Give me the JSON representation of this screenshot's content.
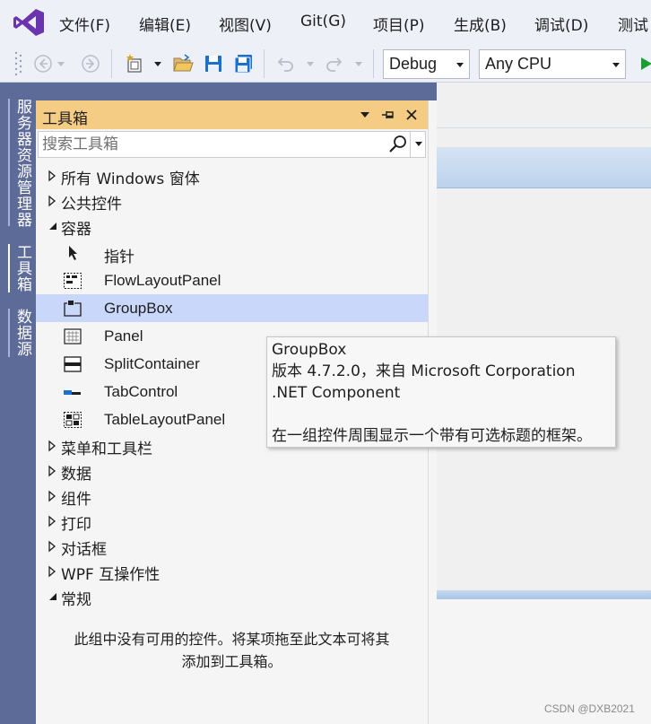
{
  "menu": {
    "items": [
      "文件(F)",
      "编辑(E)",
      "视图(V)",
      "Git(G)",
      "项目(P)",
      "生成(B)",
      "调试(D)",
      "测试"
    ]
  },
  "toolbar": {
    "configuration": "Debug",
    "platform": "Any CPU"
  },
  "side_tabs": [
    "服务器资源管理器",
    "工具箱",
    "数据源"
  ],
  "toolbox": {
    "title": "工具箱",
    "search_placeholder": "搜索工具箱",
    "groups_top": [
      {
        "label": "所有 Windows 窗体",
        "expanded": false
      },
      {
        "label": "公共控件",
        "expanded": false
      },
      {
        "label": "容器",
        "expanded": true
      }
    ],
    "container_items": [
      {
        "label": "指针",
        "icon": "pointer-icon",
        "selected": false
      },
      {
        "label": "FlowLayoutPanel",
        "icon": "flowlayoutpanel-icon",
        "selected": false
      },
      {
        "label": "GroupBox",
        "icon": "groupbox-icon",
        "selected": true
      },
      {
        "label": "Panel",
        "icon": "panel-icon",
        "selected": false
      },
      {
        "label": "SplitContainer",
        "icon": "splitcontainer-icon",
        "selected": false
      },
      {
        "label": "TabControl",
        "icon": "tabcontrol-icon",
        "selected": false
      },
      {
        "label": "TableLayoutPanel",
        "icon": "tablelayoutpanel-icon",
        "selected": false
      }
    ],
    "groups_bottom": [
      {
        "label": "菜单和工具栏",
        "expanded": false
      },
      {
        "label": "数据",
        "expanded": false
      },
      {
        "label": "组件",
        "expanded": false
      },
      {
        "label": "打印",
        "expanded": false
      },
      {
        "label": "对话框",
        "expanded": false
      },
      {
        "label": "WPF 互操作性",
        "expanded": false
      },
      {
        "label": "常规",
        "expanded": true
      }
    ],
    "empty_message_line1": "此组中没有可用的控件。将某项拖至此文本可将其",
    "empty_message_line2": "添加到工具箱。"
  },
  "tooltip": {
    "title": "GroupBox",
    "version": "版本 4.7.2.0，来自 Microsoft Corporation",
    "kind": ".NET Component",
    "description": "在一组控件周围显示一个带有可选标题的框架。"
  },
  "watermark": "CSDN @DXB2021"
}
